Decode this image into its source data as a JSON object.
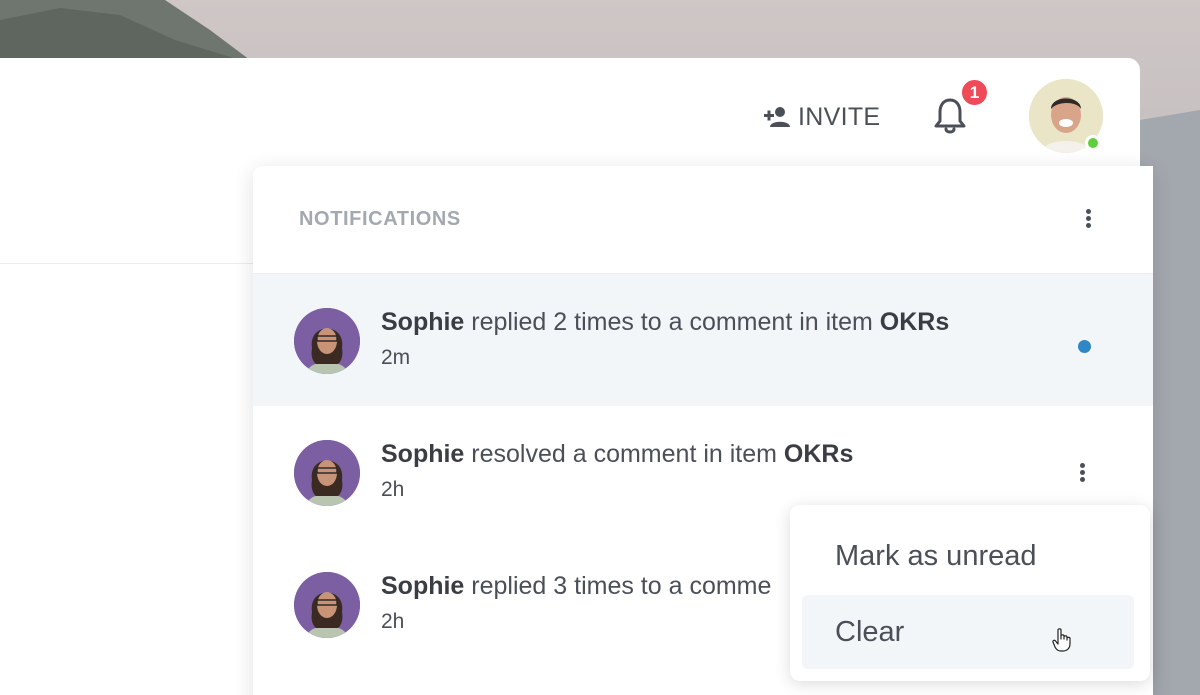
{
  "topbar": {
    "invite_label": "INVITE",
    "notification_count": "1"
  },
  "notifications": {
    "title": "NOTIFICATIONS",
    "items": [
      {
        "actor": "Sophie",
        "action": " replied 2 times to a comment in item ",
        "item": "OKRs",
        "time": "2m",
        "unread": true
      },
      {
        "actor": "Sophie",
        "action": " resolved a comment in item ",
        "item": "OKRs",
        "time": "2h",
        "unread": false
      },
      {
        "actor": "Sophie",
        "action": " replied 3 times to a comme",
        "item": "",
        "time": "2h",
        "unread": false
      }
    ]
  },
  "context_menu": {
    "items": [
      {
        "label": "Mark as unread"
      },
      {
        "label": "Clear"
      }
    ]
  },
  "colors": {
    "badge": "#ef4a57",
    "unread_dot": "#2f87c6",
    "online": "#5fcf3d",
    "unread_row_bg": "#f3f6f9"
  }
}
